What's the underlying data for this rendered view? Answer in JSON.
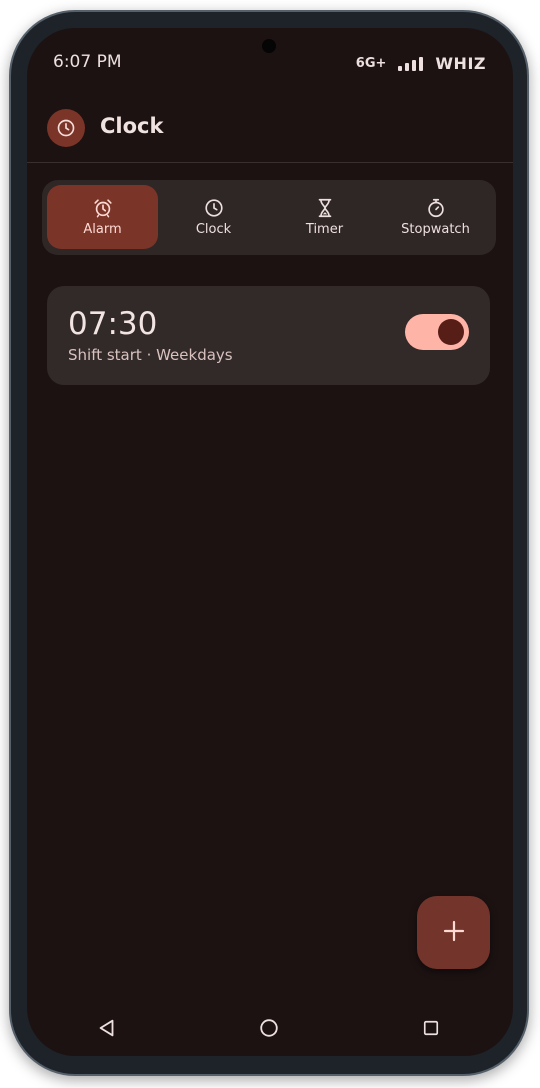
{
  "status_bar": {
    "time": "6:07 PM",
    "network": "6G+",
    "carrier": "WHIZ"
  },
  "app_bar": {
    "title": "Clock",
    "logo_icon": "clock-icon"
  },
  "tabs": [
    {
      "label": "Alarm",
      "icon": "alarm-icon",
      "active": true
    },
    {
      "label": "Clock",
      "icon": "clock-icon",
      "active": false
    },
    {
      "label": "Timer",
      "icon": "hourglass-icon",
      "active": false
    },
    {
      "label": "Stopwatch",
      "icon": "stopwatch-icon",
      "active": false
    }
  ],
  "alarms": [
    {
      "time": "07:30",
      "description": "Shift start · Weekdays",
      "enabled": true
    }
  ],
  "fab": {
    "icon": "plus-icon"
  },
  "nav": {
    "back_icon": "back-triangle-icon",
    "home_icon": "home-circle-icon",
    "recents_icon": "recents-square-icon"
  },
  "colors": {
    "background": "#1c1212",
    "surface": "#322929",
    "accent": "#7a3428",
    "toggle_track": "#ffb4a8",
    "toggle_knob": "#561e16",
    "text": "#ede0de"
  }
}
